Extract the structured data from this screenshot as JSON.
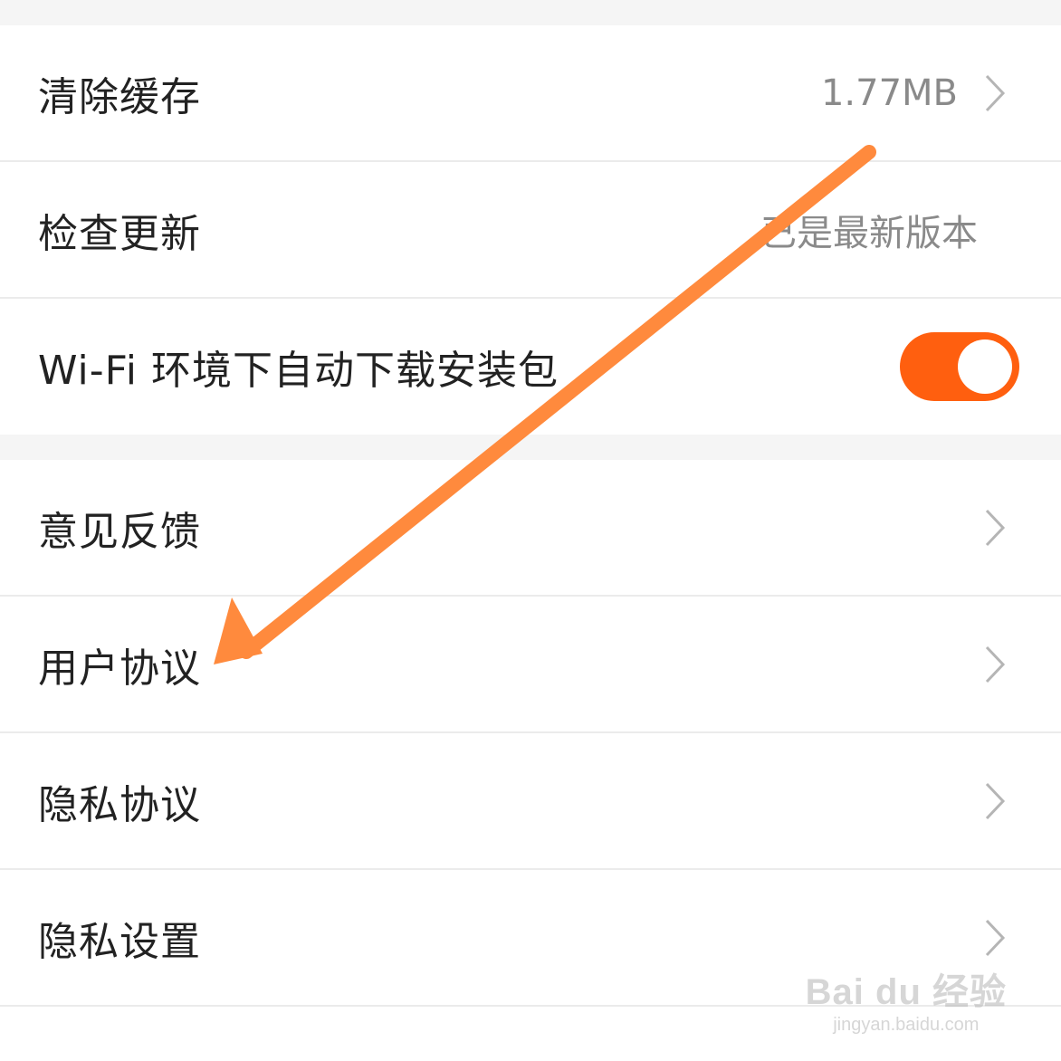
{
  "settings_group_1": [
    {
      "label": "清除缓存",
      "value": "1.77MB",
      "chevron": true
    },
    {
      "label": "检查更新",
      "value": "已是最新版本",
      "chevron": false
    },
    {
      "label": "Wi-Fi 环境下自动下载安装包",
      "toggle": true,
      "toggle_on": true
    }
  ],
  "settings_group_2": [
    {
      "label": "意见反馈",
      "chevron": true
    },
    {
      "label": "用户协议",
      "chevron": true
    },
    {
      "label": "隐私协议",
      "chevron": true
    },
    {
      "label": "隐私设置",
      "chevron": true
    }
  ],
  "colors": {
    "toggle_on": "#ff5f0f",
    "annotation_arrow": "#ff8a3d",
    "chevron": "#b5b5b5"
  },
  "watermark": {
    "brand": "Bai du 经验",
    "url": "jingyan.baidu.com"
  }
}
